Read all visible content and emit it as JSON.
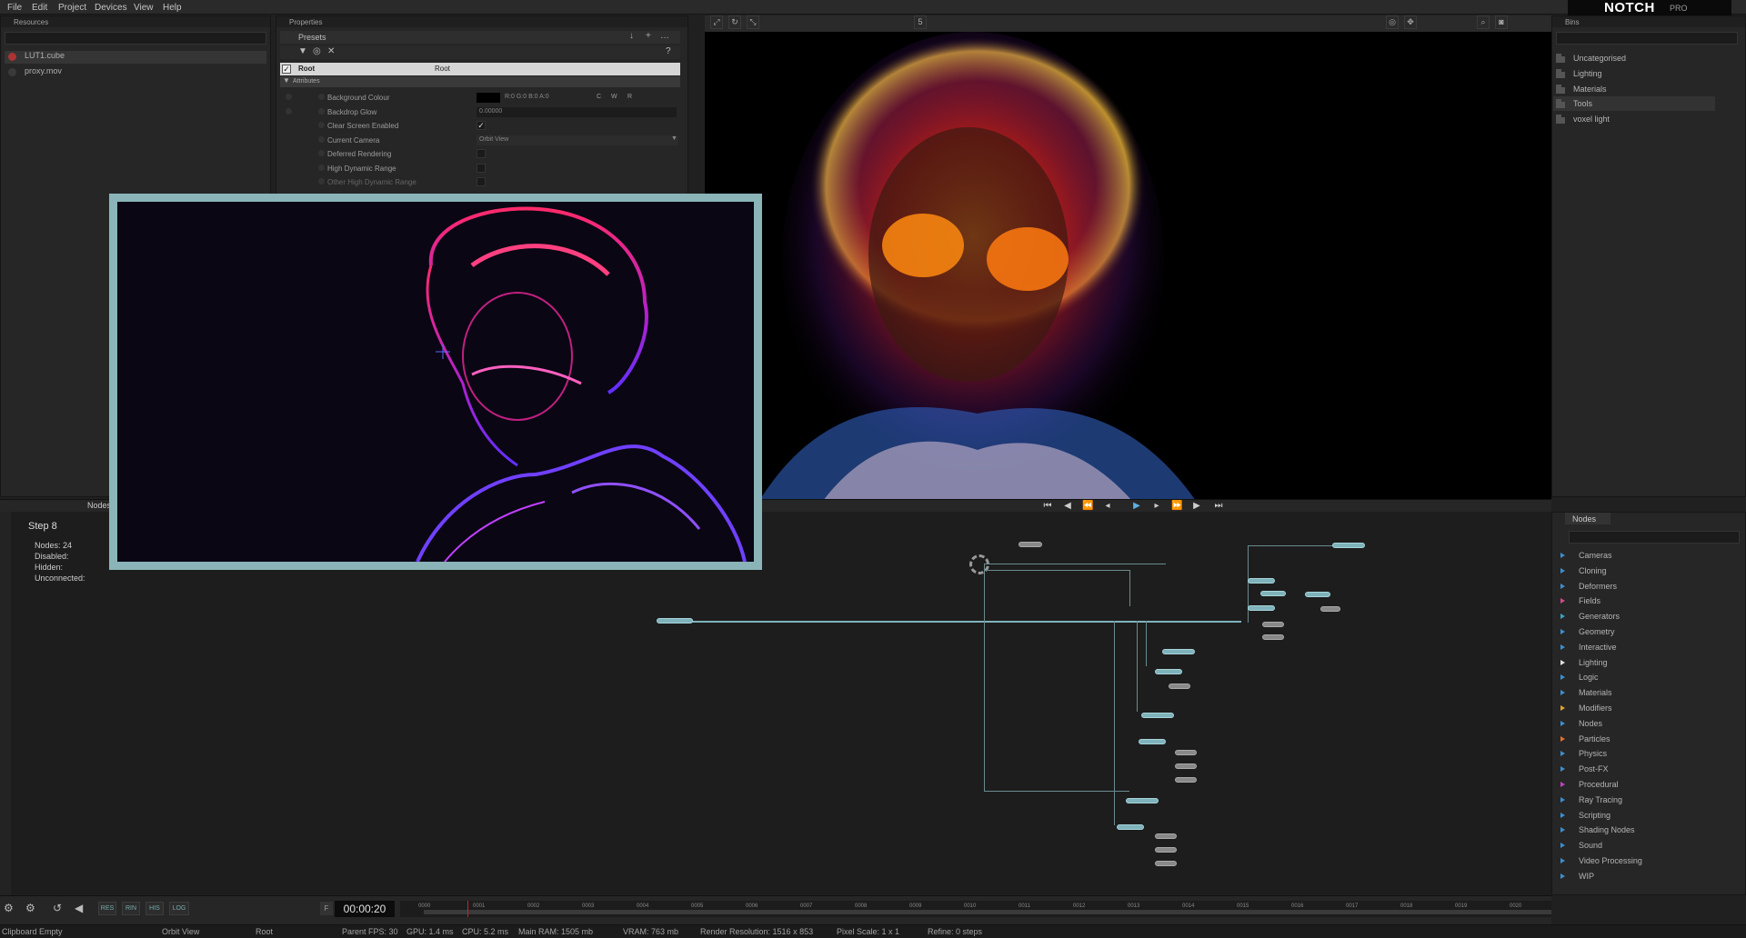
{
  "menu": [
    "File",
    "Edit",
    "Project",
    "Devices",
    "View",
    "Help"
  ],
  "logo": {
    "brand": "NOTCH",
    "edition": "PRO"
  },
  "resources": {
    "title": "Resources",
    "items": [
      {
        "name": "LUT1.cube"
      },
      {
        "name": "proxy.mov"
      }
    ]
  },
  "properties": {
    "title": "Properties",
    "presets_label": "Presets",
    "root_label": "Root",
    "root_value": "Root",
    "attributes_label": "Attributes",
    "rows": [
      {
        "label": "Background Colour",
        "value": "R:0 G:0 B:0 A:0"
      },
      {
        "label": "Backdrop Glow",
        "value": "0.00000"
      },
      {
        "label": "Clear Screen Enabled",
        "check": "✓"
      },
      {
        "label": "Current Camera",
        "value": "Orbit View"
      },
      {
        "label": "Deferred Rendering",
        "check": ""
      },
      {
        "label": "High Dynamic Range",
        "check": ""
      },
      {
        "label": "Other High Dynamic Range",
        "check": ""
      }
    ],
    "cwr": [
      "C",
      "W",
      "R"
    ]
  },
  "bins": {
    "title": "Bins",
    "items": [
      "Uncategorised",
      "Lighting",
      "Materials",
      "Tools",
      "voxel light"
    ]
  },
  "nodegraph": {
    "tab": "Nodegraph",
    "step_title": "Step 8",
    "stats": [
      {
        "k": "Nodes:",
        "v": "24"
      },
      {
        "k": "Disabled:",
        "v": ""
      },
      {
        "k": "Hidden:",
        "v": ""
      },
      {
        "k": "Unconnected:",
        "v": ""
      }
    ]
  },
  "node_tab": "Nodes",
  "node_categories": [
    {
      "name": "Cameras",
      "color": "#3a8fd0"
    },
    {
      "name": "Cloning",
      "color": "#3a8fd0"
    },
    {
      "name": "Deformers",
      "color": "#3a8fd0"
    },
    {
      "name": "Fields",
      "color": "#d04a8a"
    },
    {
      "name": "Generators",
      "color": "#3aa0c0"
    },
    {
      "name": "Geometry",
      "color": "#3a8fd0"
    },
    {
      "name": "Interactive",
      "color": "#3a8fd0"
    },
    {
      "name": "Lighting",
      "color": "#e0e0e0"
    },
    {
      "name": "Logic",
      "color": "#3a8fd0"
    },
    {
      "name": "Materials",
      "color": "#3a8fd0"
    },
    {
      "name": "Modifiers",
      "color": "#e0a030"
    },
    {
      "name": "Nodes",
      "color": "#3a8fd0"
    },
    {
      "name": "Particles",
      "color": "#e07030"
    },
    {
      "name": "Physics",
      "color": "#3a8fd0"
    },
    {
      "name": "Post-FX",
      "color": "#3a8fd0"
    },
    {
      "name": "Procedural",
      "color": "#c040c0"
    },
    {
      "name": "Ray Tracing",
      "color": "#3a8fd0"
    },
    {
      "name": "Scripting",
      "color": "#3a8fd0"
    },
    {
      "name": "Shading Nodes",
      "color": "#3a8fd0"
    },
    {
      "name": "Sound",
      "color": "#3a8fd0"
    },
    {
      "name": "Video Processing",
      "color": "#3a8fd0"
    },
    {
      "name": "WIP",
      "color": "#3a8fd0"
    }
  ],
  "timeline": {
    "time": "00:00:20",
    "ticks": [
      "0000",
      "0001",
      "0002",
      "0003",
      "0004",
      "0005",
      "0006",
      "0007",
      "0008",
      "0009",
      "0010",
      "0011",
      "0012",
      "0013",
      "0014",
      "0015",
      "0016",
      "0017",
      "0018",
      "0019",
      "0020"
    ],
    "buttons": [
      "RES",
      "RIN",
      "HIS",
      "LOG"
    ]
  },
  "status": [
    "Clipboard Empty",
    "Orbit View",
    "Root",
    "Parent FPS: 30",
    "GPU: 1.4 ms",
    "CPU: 5.2 ms",
    "Main RAM: 1505 mb",
    "VRAM: 763 mb",
    "Render Resolution: 1516 x 853",
    "Pixel Scale: 1 x 1",
    "Refine: 0 steps"
  ],
  "viewer_top_icon": "5",
  "colors": {
    "accent": "#7fb3bb",
    "panel": "#262626",
    "bg": "#202020",
    "overlay_border": "#8ab4b8"
  }
}
